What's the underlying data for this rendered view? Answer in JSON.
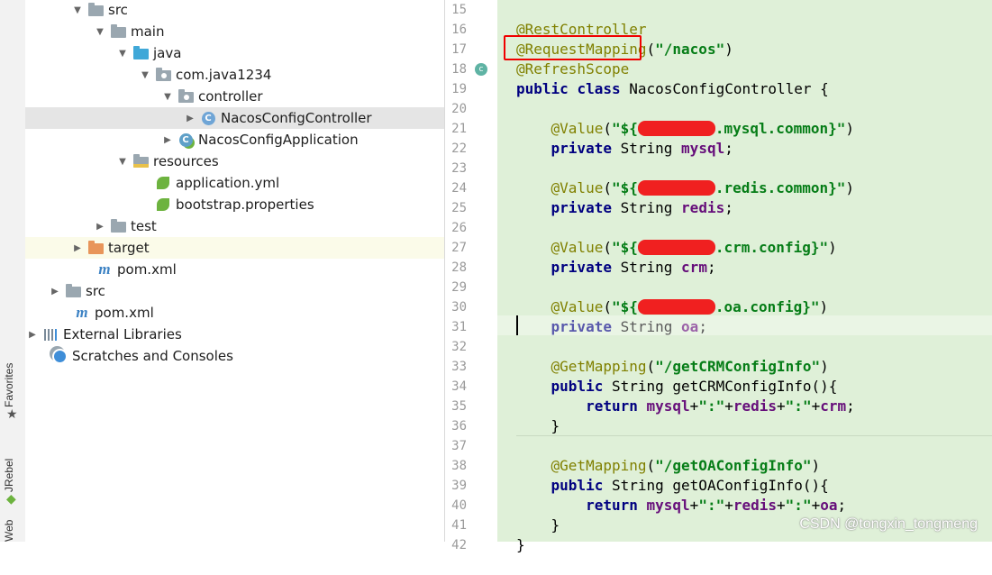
{
  "left_stripe": {
    "favorites": "Favorites",
    "jrebel": "JRebel",
    "web": "Web"
  },
  "project_tree": [
    {
      "label": "src",
      "icon": "folder-icon"
    },
    {
      "label": "main",
      "icon": "folder-icon"
    },
    {
      "label": "java",
      "icon": "source-folder-icon"
    },
    {
      "label": "com.java1234",
      "icon": "package-icon"
    },
    {
      "label": "controller",
      "icon": "package-icon"
    },
    {
      "label": "NacosConfigController",
      "icon": "class-icon"
    },
    {
      "label": "NacosConfigApplication",
      "icon": "spring-boot-class-icon"
    },
    {
      "label": "resources",
      "icon": "resources-folder-icon"
    },
    {
      "label": "application.yml",
      "icon": "spring-config-icon"
    },
    {
      "label": "bootstrap.properties",
      "icon": "spring-config-icon"
    },
    {
      "label": "test",
      "icon": "folder-icon"
    },
    {
      "label": "target",
      "icon": "excluded-folder-icon"
    },
    {
      "label": "pom.xml",
      "icon": "maven-icon"
    },
    {
      "label": "src",
      "icon": "folder-icon"
    },
    {
      "label": "pom.xml",
      "icon": "maven-icon"
    },
    {
      "label": "External Libraries",
      "icon": "library-icon"
    },
    {
      "label": "Scratches and Consoles",
      "icon": "scratches-icon"
    }
  ],
  "editor": {
    "line_numbers": [
      "15",
      "16",
      "17",
      "18",
      "19",
      "20",
      "21",
      "22",
      "23",
      "24",
      "25",
      "26",
      "27",
      "28",
      "29",
      "30",
      "31",
      "32",
      "33",
      "34",
      "35",
      "36",
      "37",
      "38",
      "39",
      "40",
      "41",
      "42"
    ],
    "tokens": {
      "rest_controller": "@RestController",
      "request_mapping": "@RequestMapping",
      "request_path": "\"/nacos\"",
      "refresh_scope": "@RefreshScope",
      "public": "public",
      "class": "class",
      "class_name": "NacosConfigController {",
      "value": "@Value",
      "dollar": "\"${",
      "mysql_key": ".mysql.common}\"",
      "redis_key": ".redis.common}\"",
      "crm_key": ".crm.config}\"",
      "oa_key": ".oa.config}\"",
      "private": "private",
      "string_type": "String",
      "mysql": "mysql",
      "redis": "redis",
      "crm": "crm",
      "oa": "oa",
      "get_mapping": "@GetMapping",
      "crm_path": "\"/getCRMConfigInfo\"",
      "oa_path": "\"/getOAConfigInfo\"",
      "crm_method": "getCRMConfigInfo(){",
      "oa_method": "getOAConfigInfo(){",
      "return": "return",
      "colon_str": "\":\"",
      "plus": "+",
      "open_paren": "(",
      "close_paren": ")",
      "semicolon": ";",
      "close_brace": "}"
    }
  },
  "watermark": "CSDN @tongxin_tongmeng",
  "colors": {
    "editor_bg": "#dff0d8",
    "annotation": "#808000",
    "string": "#067d17",
    "keyword": "#000080",
    "field": "#660e7a",
    "highlight_box": "#f00000"
  }
}
